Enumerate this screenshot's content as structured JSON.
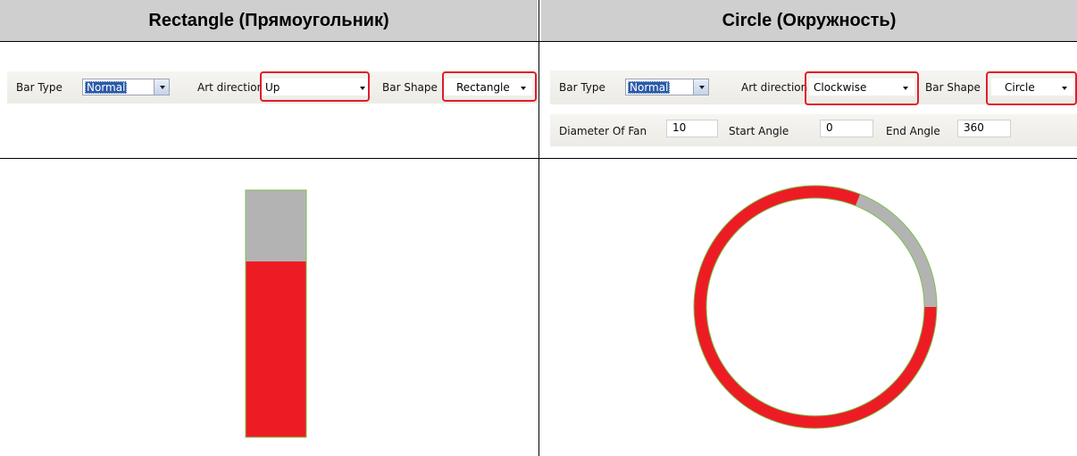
{
  "left": {
    "title": "Rectangle (Прямоугольник)",
    "bar_type_label": "Bar Type",
    "bar_type_value": "Normal",
    "art_direction_label": "Art direction",
    "art_direction_value": "Up",
    "bar_shape_label": "Bar Shape",
    "bar_shape_value": "Rectangle",
    "fill_fraction": 0.71
  },
  "right": {
    "title": "Circle (Окружность)",
    "bar_type_label": "Bar Type",
    "bar_type_value": "Normal",
    "art_direction_label": "Art direction",
    "art_direction_value": "Clockwise",
    "bar_shape_label": "Bar Shape",
    "bar_shape_value": "Circle",
    "diameter_label": "Diameter Of Fan",
    "diameter_value": "10",
    "start_angle_label": "Start Angle",
    "start_angle_value": "0",
    "end_angle_label": "End Angle",
    "end_angle_value": "360",
    "fill_fraction": 0.81
  },
  "colors": {
    "header_bg": "#cfcfcf",
    "fill": "#ed1c24",
    "empty": "#b3b3b3",
    "outline": "#7dc04c",
    "highlight": "#e01e2a"
  }
}
